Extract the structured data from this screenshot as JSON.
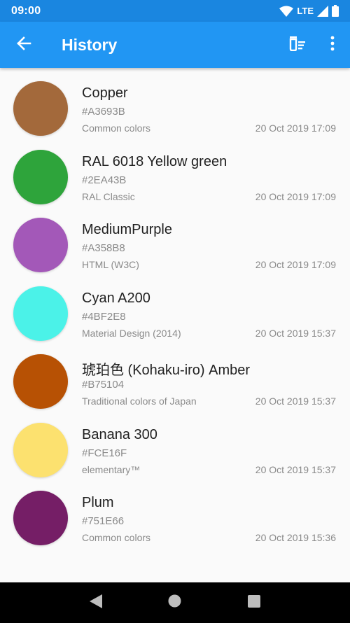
{
  "status_bar": {
    "time": "09:00",
    "network": "LTE",
    "icons": [
      "wifi-icon",
      "signal-icon",
      "battery-icon"
    ]
  },
  "app_bar": {
    "title": "History",
    "actions": [
      "back-arrow-icon",
      "clear-history-icon",
      "more-vert-icon"
    ]
  },
  "colors": {
    "app_bar": "#2196F3",
    "status_bar": "#1A86E0"
  },
  "items": [
    {
      "name": "Copper",
      "hex": "#A3693B",
      "source": "Common colors",
      "date": "20 Oct 2019 17:09"
    },
    {
      "name": "RAL 6018 Yellow green",
      "hex": "#2EA43B",
      "source": "RAL Classic",
      "date": "20 Oct 2019 17:09"
    },
    {
      "name": "MediumPurple",
      "hex": "#A358B8",
      "source": "HTML (W3C)",
      "date": "20 Oct 2019 17:09"
    },
    {
      "name": "Cyan A200",
      "hex": "#4BF2E8",
      "source": "Material Design (2014)",
      "date": "20 Oct 2019 15:37"
    },
    {
      "name": "琥珀色 (Kohaku-iro) Amber",
      "hex": "#B75104",
      "source": "Traditional colors of Japan",
      "date": "20 Oct 2019 15:37"
    },
    {
      "name": "Banana 300",
      "hex": "#FCE16F",
      "source": "elementary™",
      "date": "20 Oct 2019 15:37"
    },
    {
      "name": "Plum",
      "hex": "#751E66",
      "source": "Common colors",
      "date": "20 Oct 2019 15:36"
    }
  ],
  "nav_bar": [
    "back-triangle-icon",
    "home-circle-icon",
    "recents-square-icon"
  ]
}
